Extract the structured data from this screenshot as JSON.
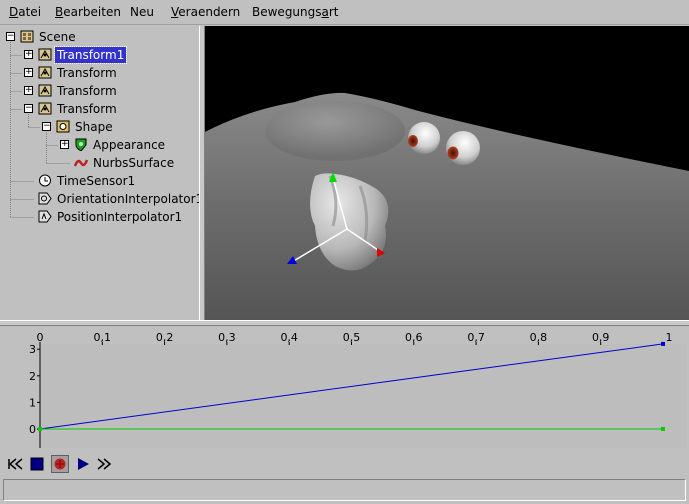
{
  "menu": [
    {
      "pre": "",
      "u": "D",
      "post": "atei"
    },
    {
      "pre": "",
      "u": "B",
      "post": "earbeiten"
    },
    {
      "pre": "Neu",
      "u": "",
      "post": ""
    },
    {
      "pre": "",
      "u": "V",
      "post": "eraendern"
    },
    {
      "pre": "Bewegungs",
      "u": "a",
      "post": "rt"
    }
  ],
  "tree": {
    "nodes": [
      {
        "label": "Scene",
        "icon": "scene-icon"
      },
      {
        "label": "Transform1",
        "icon": "transform-icon",
        "selected": true
      },
      {
        "label": "Transform",
        "icon": "transform-icon"
      },
      {
        "label": "Transform",
        "icon": "transform-icon"
      },
      {
        "label": "Transform",
        "icon": "transform-icon"
      },
      {
        "label": "Shape",
        "icon": "shape-icon"
      },
      {
        "label": "Appearance",
        "icon": "appearance-icon"
      },
      {
        "label": "NurbsSurface",
        "icon": "nurbs-icon"
      },
      {
        "label": "TimeSensor1",
        "icon": "clock-icon"
      },
      {
        "label": "OrientationInterpolator1",
        "icon": "interpolator-icon"
      },
      {
        "label": "PositionInterpolator1",
        "icon": "interpolator-icon"
      }
    ]
  },
  "chart_data": {
    "type": "line",
    "x_ticks": [
      "0",
      "0,1",
      "0,2",
      "0,3",
      "0,4",
      "0,5",
      "0,6",
      "0,7",
      "0,8",
      "0,9",
      "1"
    ],
    "y_ticks": [
      "0",
      "1",
      "2",
      "3"
    ],
    "xlim": [
      0,
      1
    ],
    "ylim": [
      0,
      3.3
    ],
    "series": [
      {
        "color": "#0000cc",
        "points": [
          [
            0,
            0
          ],
          [
            1,
            3.2
          ]
        ]
      },
      {
        "color": "#00cc00",
        "points": [
          [
            0,
            0
          ],
          [
            1,
            0
          ]
        ]
      }
    ]
  },
  "playback": {
    "buttons": [
      "rewind-icon",
      "stop-icon",
      "record-icon",
      "play-icon",
      "fast-forward-icon"
    ]
  },
  "status": {
    "text": ""
  }
}
